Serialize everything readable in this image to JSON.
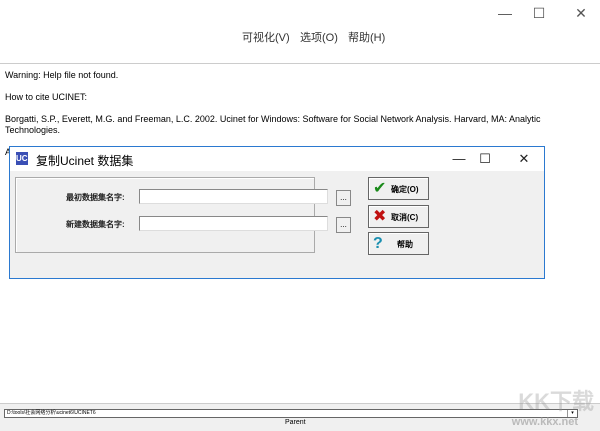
{
  "window": {
    "minimize": "—",
    "maximize": "☐",
    "close": "✕"
  },
  "menu": [
    "可视化(V)",
    "选项(O)",
    "帮助(H)"
  ],
  "content": {
    "lines": [
      "Warning: Help file not found.",
      "How to cite UCINET:",
      "Borgatti, S.P., Everett, M.G. and Freeman, L.C. 2002. Ucinet for Windows: Software for Social Network Analysis. Harvard, MA: Analytic Technologies."
    ],
    "partial": "A"
  },
  "dialog": {
    "title": "复制Ucinet 数据集",
    "icon": "UCI",
    "original_label": "最初数据集名字:",
    "original_value": "",
    "new_label": "新建数据集名字:",
    "new_value": "",
    "browse": "...",
    "ok": "确定(O)",
    "cancel": "取消(C)",
    "help": "帮助"
  },
  "bottom": {
    "path": "D:\\tools\\社会网络分析\\ucinet6\\UCINET6",
    "status": "Parent"
  },
  "watermark": {
    "logo": "KK下载",
    "url": "www.kkx.net"
  }
}
